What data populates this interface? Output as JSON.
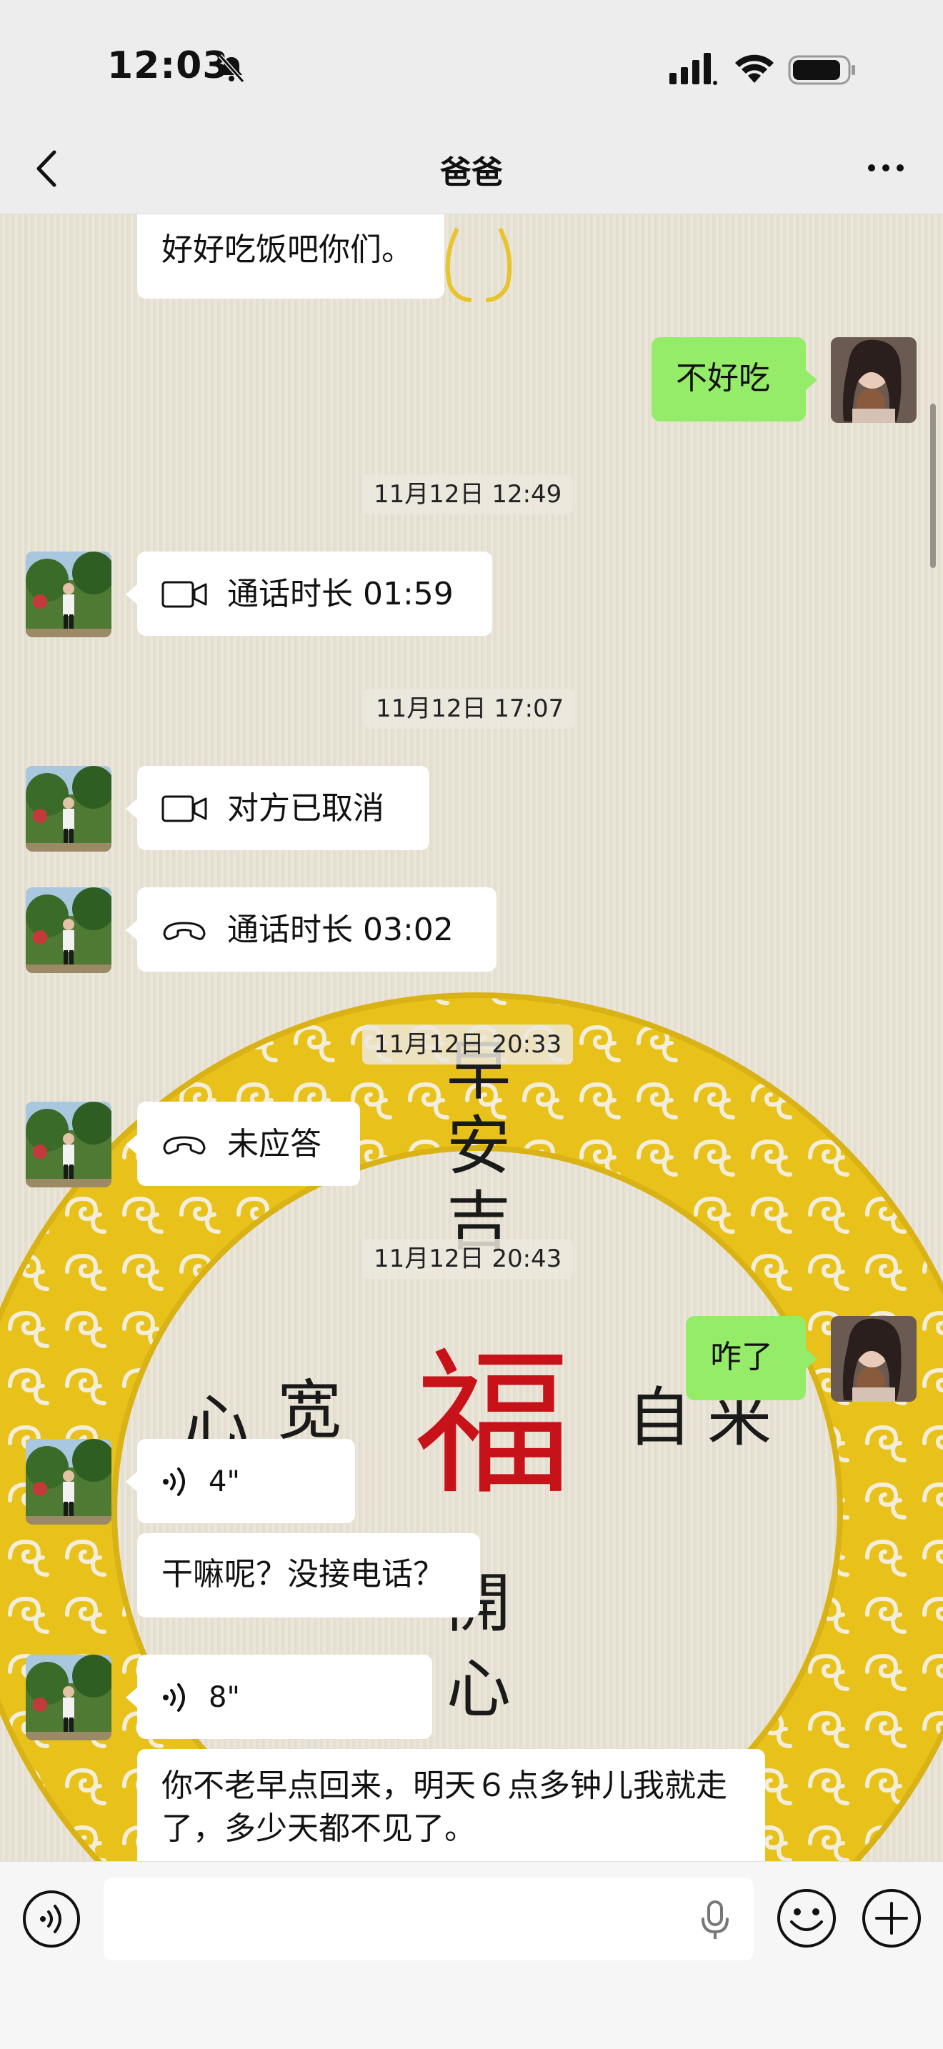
{
  "status": {
    "time": "12:03"
  },
  "header": {
    "title": "爸爸"
  },
  "messages": [
    {
      "text": "好好吃饭吧你们。"
    },
    {
      "text": "不好吃"
    },
    {
      "time": "11月12日 12:49"
    },
    {
      "text": "通话时长 01:59"
    },
    {
      "time": "11月12日 17:07"
    },
    {
      "text": "对方已取消"
    },
    {
      "text": "通话时长 03:02"
    },
    {
      "time": "11月12日 20:33"
    },
    {
      "text": "未应答"
    },
    {
      "time": "11月12日 20:43"
    },
    {
      "text": "咋了"
    },
    {
      "text": "4\""
    },
    {
      "text": "干嘛呢？没接电话？"
    },
    {
      "text": "8\""
    },
    {
      "text": "你不老早点回来，明天６点多钟儿我就走了，多少天都不见了。"
    }
  ],
  "wallpaper": {
    "chars": [
      "早",
      "安",
      "吉",
      "福",
      "心",
      "宽",
      "自",
      "来",
      "開",
      "心"
    ]
  },
  "colors": {
    "self_bubble": "#95ec69",
    "other_bubble": "#ffffff",
    "nav_bg": "#ededed",
    "wallpaper_ring": "#e8c21a"
  },
  "icons": [
    "bell-mute-icon",
    "signal-icon",
    "wifi-icon",
    "battery-icon",
    "back-icon",
    "more-icon",
    "video-call-icon",
    "phone-call-icon",
    "voice-wave-icon",
    "voice-mode-icon",
    "microphone-icon",
    "emoji-icon",
    "plus-icon"
  ]
}
